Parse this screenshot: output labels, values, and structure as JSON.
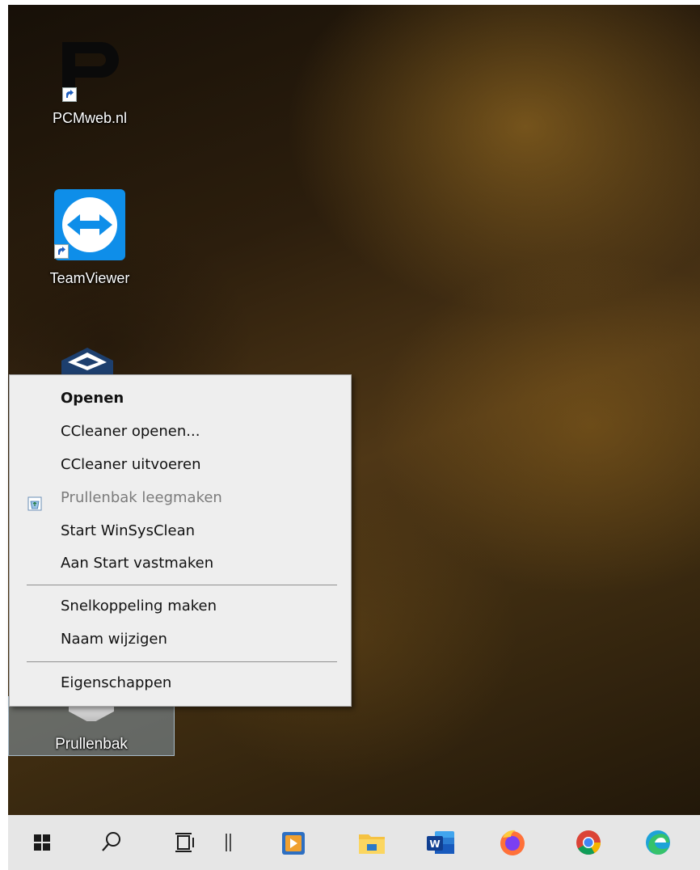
{
  "desktop": {
    "icons": {
      "pcmweb": {
        "label": "PCMweb.nl"
      },
      "teamviewer": {
        "label": "TeamViewer"
      },
      "virtualbox": {
        "label": ""
      },
      "recycle_bin": {
        "label": "Prullenbak"
      }
    }
  },
  "context_menu": {
    "items": [
      {
        "label": "Openen"
      },
      {
        "label": "CCleaner openen..."
      },
      {
        "label": "CCleaner uitvoeren"
      },
      {
        "label": "Prullenbak leegmaken"
      },
      {
        "label": "Start WinSysClean"
      },
      {
        "label": "Aan Start vastmaken"
      },
      {
        "label": "Snelkoppeling maken"
      },
      {
        "label": "Naam wijzigen"
      },
      {
        "label": "Eigenschappen"
      }
    ]
  },
  "taskbar": {
    "buttons": [
      "windows-start-icon",
      "search-icon",
      "task-view-icon",
      "divider-icon",
      "app-icon",
      "file-explorer-icon",
      "word-icon",
      "firefox-icon",
      "chrome-icon",
      "edge-icon"
    ]
  },
  "colors": {
    "menu_background": "#eeeeee",
    "disabled_text": "#7b7b7b",
    "taskbar": "#e6e6e6",
    "teamviewer_blue": "#0e8ee9"
  }
}
